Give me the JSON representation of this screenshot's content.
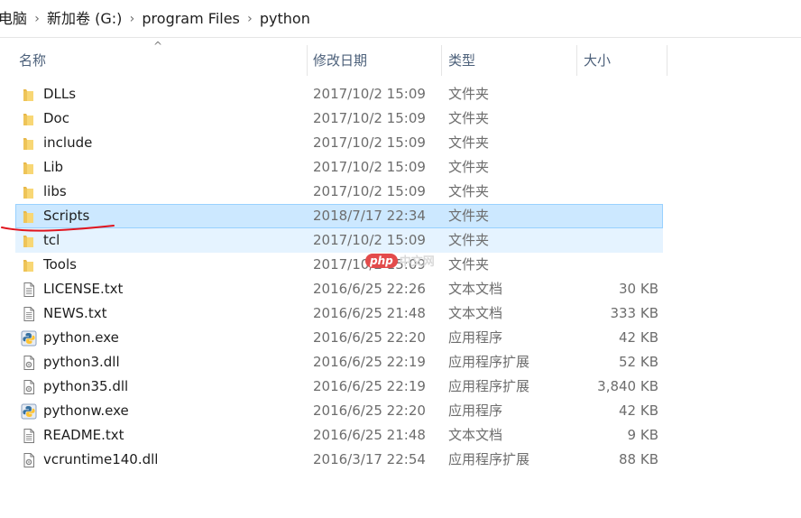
{
  "breadcrumb": {
    "items": [
      "电脑",
      "新加卷 (G:)",
      "program Files",
      "python"
    ],
    "separator": "›"
  },
  "header": {
    "sort_indicator": "^",
    "columns": {
      "name": "名称",
      "date": "修改日期",
      "type": "类型",
      "size": "大小"
    }
  },
  "files": [
    {
      "name": "DLLs",
      "date": "2017/10/2 15:09",
      "type": "文件夹",
      "size": "",
      "icon": "folder-icon"
    },
    {
      "name": "Doc",
      "date": "2017/10/2 15:09",
      "type": "文件夹",
      "size": "",
      "icon": "folder-icon"
    },
    {
      "name": "include",
      "date": "2017/10/2 15:09",
      "type": "文件夹",
      "size": "",
      "icon": "folder-icon"
    },
    {
      "name": "Lib",
      "date": "2017/10/2 15:09",
      "type": "文件夹",
      "size": "",
      "icon": "folder-icon"
    },
    {
      "name": "libs",
      "date": "2017/10/2 15:09",
      "type": "文件夹",
      "size": "",
      "icon": "folder-icon"
    },
    {
      "name": "Scripts",
      "date": "2018/7/17 22:34",
      "type": "文件夹",
      "size": "",
      "icon": "folder-icon"
    },
    {
      "name": "tcl",
      "date": "2017/10/2 15:09",
      "type": "文件夹",
      "size": "",
      "icon": "folder-icon"
    },
    {
      "name": "Tools",
      "date": "2017/10/2 15:09",
      "type": "文件夹",
      "size": "",
      "icon": "folder-icon"
    },
    {
      "name": "LICENSE.txt",
      "date": "2016/6/25 22:26",
      "type": "文本文档",
      "size": "30 KB",
      "icon": "text-file-icon"
    },
    {
      "name": "NEWS.txt",
      "date": "2016/6/25 21:48",
      "type": "文本文档",
      "size": "333 KB",
      "icon": "text-file-icon"
    },
    {
      "name": "python.exe",
      "date": "2016/6/25 22:20",
      "type": "应用程序",
      "size": "42 KB",
      "icon": "python-exe-icon"
    },
    {
      "name": "python3.dll",
      "date": "2016/6/25 22:19",
      "type": "应用程序扩展",
      "size": "52 KB",
      "icon": "dll-file-icon"
    },
    {
      "name": "python35.dll",
      "date": "2016/6/25 22:19",
      "type": "应用程序扩展",
      "size": "3,840 KB",
      "icon": "dll-file-icon"
    },
    {
      "name": "pythonw.exe",
      "date": "2016/6/25 22:20",
      "type": "应用程序",
      "size": "42 KB",
      "icon": "python-exe-icon"
    },
    {
      "name": "README.txt",
      "date": "2016/6/25 21:48",
      "type": "文本文档",
      "size": "9 KB",
      "icon": "text-file-icon"
    },
    {
      "name": "vcruntime140.dll",
      "date": "2016/3/17 22:54",
      "type": "应用程序扩展",
      "size": "88 KB",
      "icon": "dll-file-icon"
    }
  ],
  "state": {
    "selected_row": "Scripts",
    "hover_row": "tcl"
  },
  "watermark": {
    "logo": "php",
    "text": "中文网"
  },
  "colors": {
    "selected_bg": "#cce8ff",
    "selected_border": "#99d1ff",
    "hover_bg": "#e5f3ff",
    "folder": "#f8d775",
    "annotation": "#e0141e"
  }
}
